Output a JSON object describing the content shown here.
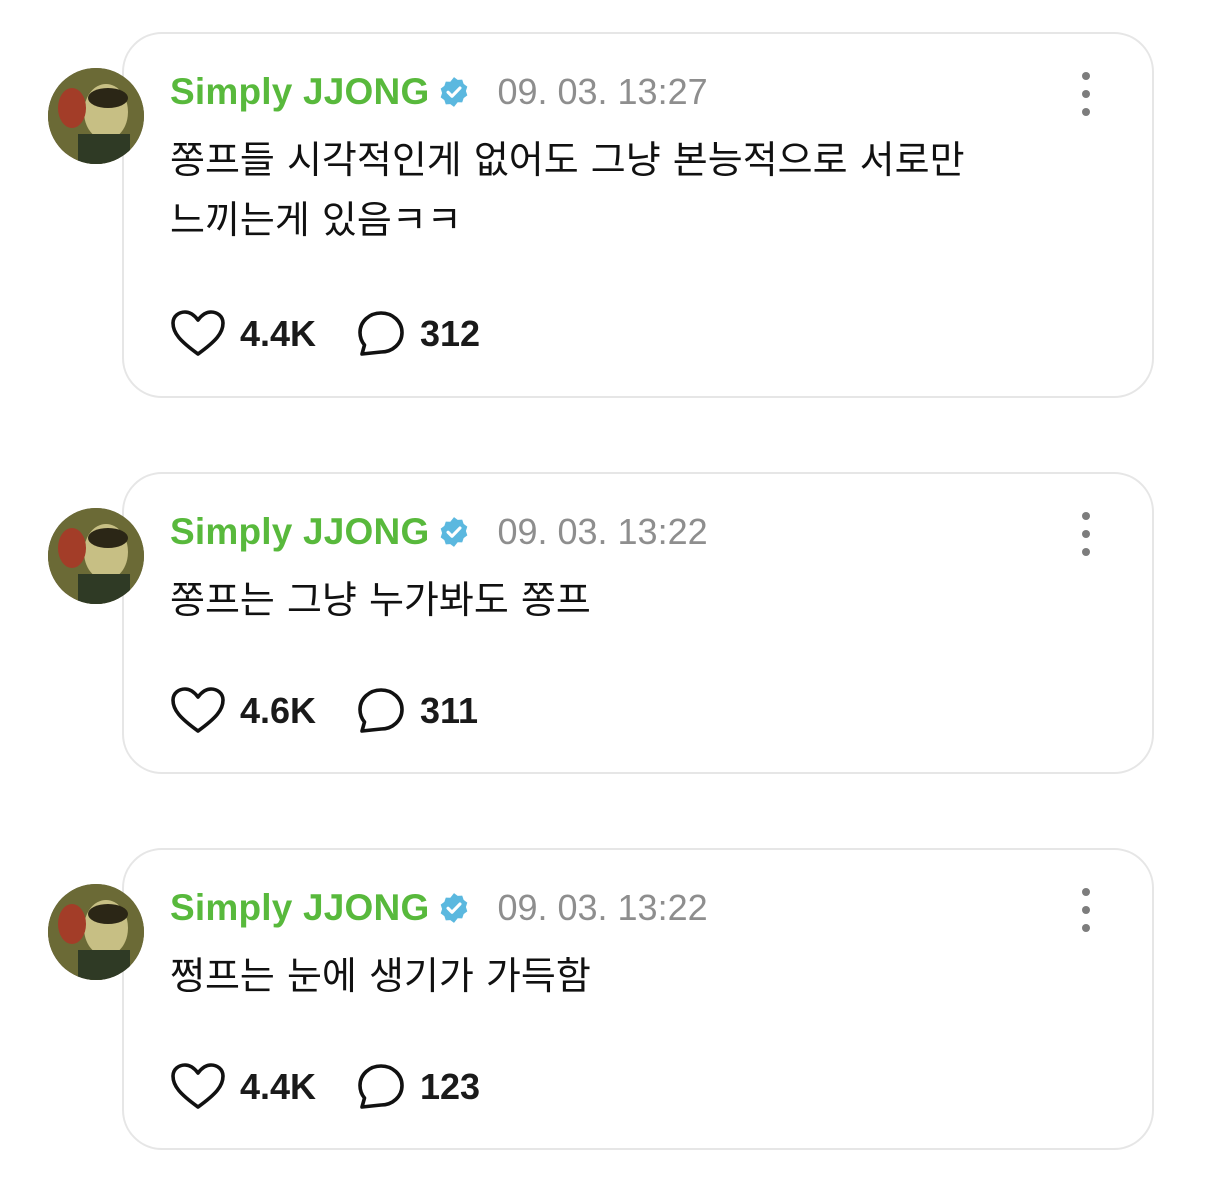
{
  "colors": {
    "username": "#58b93c",
    "verified_badge": "#5bb8df",
    "timestamp": "#8e8e8e",
    "text": "#111111",
    "card_border": "#e6e6e6"
  },
  "posts": [
    {
      "username": "Simply JJONG",
      "verified_icon": "verified-badge-icon",
      "timestamp": "09. 03. 13:27",
      "text": "쫑프들 시각적인게 없어도 그냥 본능적으로 서로만\n느끼는게 있음ㅋㅋ",
      "likes": "4.4K",
      "comments": "312"
    },
    {
      "username": "Simply JJONG",
      "verified_icon": "verified-badge-icon",
      "timestamp": "09. 03. 13:22",
      "text": "쫑프는 그냥 누가봐도 쫑프",
      "likes": "4.6K",
      "comments": "311"
    },
    {
      "username": "Simply JJONG",
      "verified_icon": "verified-badge-icon",
      "timestamp": "09. 03. 13:22",
      "text": "쩡프는 눈에 생기가 가득함",
      "likes": "4.4K",
      "comments": "123"
    }
  ]
}
